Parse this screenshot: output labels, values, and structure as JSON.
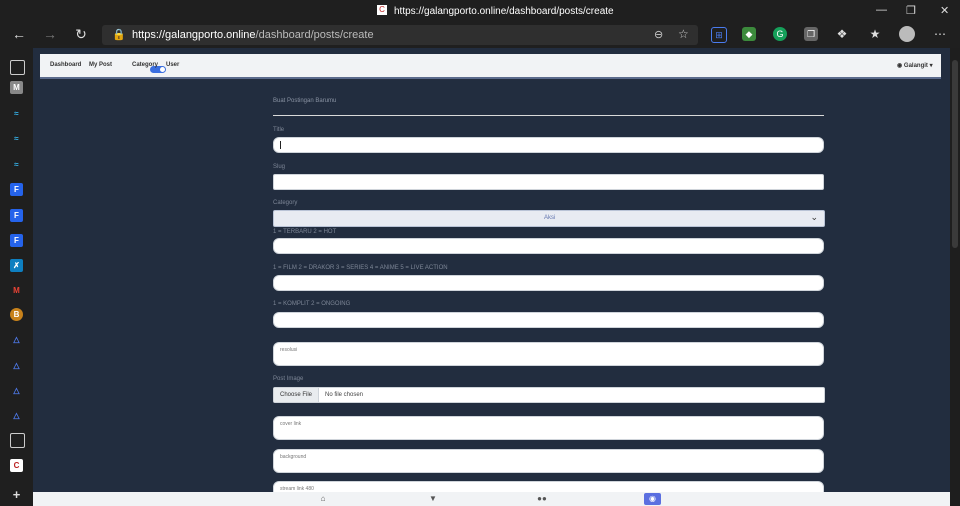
{
  "browser": {
    "title": "https://galangporto.online/dashboard/posts/create",
    "favicon": "C",
    "url_domain": "https://galangporto.online",
    "url_path": "/dashboard/posts/create"
  },
  "nav": {
    "dashboard": "Dashboard",
    "my_posts": "My Post",
    "category": "Category",
    "user": "User",
    "account": "Galangit"
  },
  "form": {
    "heading": "Buat Postingan Barumu",
    "title_label": "Title",
    "slug_label": "Slug",
    "category_label": "Category",
    "category_value": "Aksi",
    "hint_status": "1 = TERBARU 2 = HOT",
    "hint_type": "1 = FILM 2 = DRAKOR 3 = SERIES 4 = ANIME 5 = LIVE ACTION",
    "hint_progress": "1 = KOMPLIT 2 = ONGOING",
    "resolusi_placeholder": "resolusi",
    "image_label": "Post Image",
    "choose_file": "Choose File",
    "no_file": "No file chosen",
    "cover_placeholder": "cover link",
    "background_placeholder": "background",
    "stream_placeholder": "stream link 480"
  },
  "icons": {
    "back": "arrow-left-icon",
    "forward": "arrow-right-icon",
    "refresh": "refresh-icon",
    "lock": "lock-icon",
    "bottom_home": "home-icon",
    "bottom_filter": "filter-icon",
    "bottom_users": "users-icon",
    "bottom_account": "user-circle-icon"
  },
  "colors": {
    "page_bg": "#222d3f",
    "accent": "#5b6fe0"
  }
}
